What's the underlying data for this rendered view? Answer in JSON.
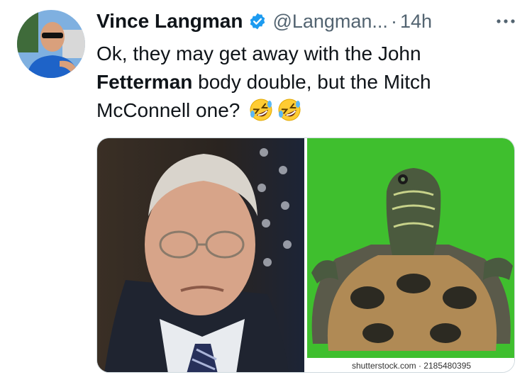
{
  "author": {
    "name": "Vince Langman",
    "handle": "@Langman...",
    "separator": "·",
    "time": "14h"
  },
  "icons": {
    "verified": "verified-badge-icon",
    "more": "more-options-icon",
    "emoji": "rolling-on-floor-laughing-emoji"
  },
  "tweet": {
    "text_part1": "Ok, they may get away with the John ",
    "text_bold": "Fetterman",
    "text_part2": " body double, but the Mitch McConnell one?"
  },
  "media": {
    "watermark": "shutterstock.com · 2185480395"
  },
  "colors": {
    "verified": "#1d9bf0",
    "secondary_text": "#536471",
    "turtle_background": "#3fbf2e"
  }
}
